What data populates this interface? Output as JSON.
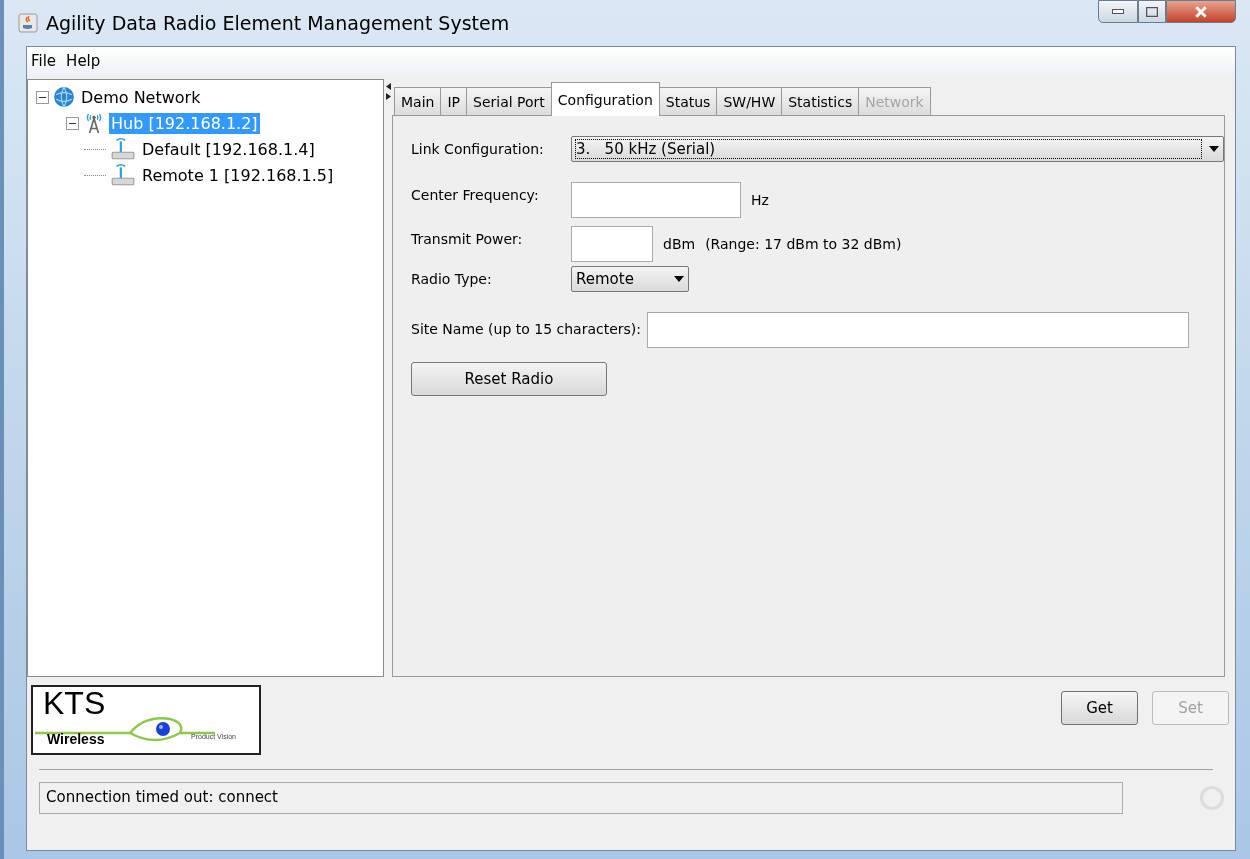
{
  "window": {
    "title": "Agility Data Radio Element Management System"
  },
  "menu": [
    "File",
    "Help"
  ],
  "tree": [
    {
      "label": "Demo Network",
      "kind": "network",
      "expanded": true,
      "selected": false,
      "children": [
        {
          "label": "Hub [192.168.1.2]",
          "kind": "hub",
          "expanded": true,
          "selected": true,
          "children": [
            {
              "label": "Default [192.168.1.4]",
              "kind": "radio",
              "selected": false
            },
            {
              "label": "Remote 1 [192.168.1.5]",
              "kind": "radio",
              "selected": false
            }
          ]
        }
      ]
    }
  ],
  "tabs": [
    {
      "label": "Main",
      "selected": false,
      "disabled": false
    },
    {
      "label": "IP",
      "selected": false,
      "disabled": false
    },
    {
      "label": "Serial Port",
      "selected": false,
      "disabled": false
    },
    {
      "label": "Configuration",
      "selected": true,
      "disabled": false
    },
    {
      "label": "Status",
      "selected": false,
      "disabled": false
    },
    {
      "label": "SW/HW",
      "selected": false,
      "disabled": false
    },
    {
      "label": "Statistics",
      "selected": false,
      "disabled": false
    },
    {
      "label": "Network",
      "selected": false,
      "disabled": true
    }
  ],
  "form": [
    {
      "kind": "combo",
      "label": "Link Configuration:",
      "value": "3.   50 kHz (Serial)"
    },
    {
      "kind": "text",
      "label": "Center Frequency:",
      "unit": "Hz"
    },
    {
      "kind": "text",
      "label": "Transmit Power:",
      "unit": "dBm",
      "note": "(Range: 17 dBm to 32 dBm)"
    },
    {
      "kind": "combo",
      "label": "Radio Type:",
      "value": "Remote"
    },
    {
      "kind": "text",
      "label": "Site Name (up to 15 characters):"
    }
  ],
  "reset_button": {
    "label": "Reset Radio",
    "disabled": false
  },
  "logo": {
    "title": "KTS",
    "subtitle": "Wireless",
    "tagline": "Product Vision"
  },
  "buttons": [
    {
      "label": "Get",
      "disabled": false
    },
    {
      "label": "Set",
      "disabled": true
    }
  ],
  "status_bar": "Connection timed out: connect"
}
